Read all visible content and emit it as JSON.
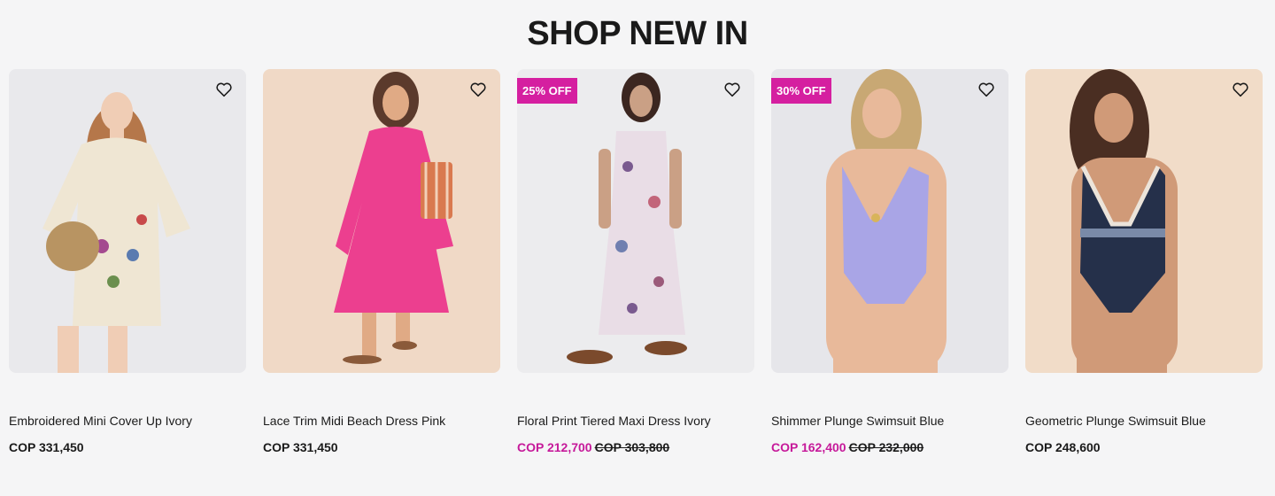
{
  "section": {
    "title": "SHOP NEW IN"
  },
  "products": [
    {
      "name": "Embroidered Mini Cover Up Ivory",
      "price": "COP 331,450",
      "sale_price": "",
      "old_price": "",
      "badge": "",
      "bg": "#e9e9ec",
      "garment": "#efe6d3"
    },
    {
      "name": "Lace Trim Midi Beach Dress Pink",
      "price": "COP 331,450",
      "sale_price": "",
      "old_price": "",
      "badge": "",
      "bg": "#f0d9c6",
      "garment": "#ec3f8f"
    },
    {
      "name": "Floral Print Tiered Maxi Dress Ivory",
      "price": "",
      "sale_price": "COP 212,700",
      "old_price": "COP 303,800",
      "badge": "25% OFF",
      "bg": "#ececee",
      "garment": "#e9dde6"
    },
    {
      "name": "Shimmer Plunge Swimsuit Blue",
      "price": "",
      "sale_price": "COP 162,400",
      "old_price": "COP 232,000",
      "badge": "30% OFF",
      "bg": "#e6e6ea",
      "garment": "#a9a5e6"
    },
    {
      "name": "Geometric Plunge Swimsuit Blue",
      "price": "COP 248,600",
      "sale_price": "",
      "old_price": "",
      "badge": "",
      "bg": "#f1dcc8",
      "garment": "#25304a"
    }
  ],
  "colors": {
    "accent": "#d51fa0",
    "sale_text": "#c6199a"
  },
  "icons": {
    "wishlist": "heart-outline-icon"
  }
}
